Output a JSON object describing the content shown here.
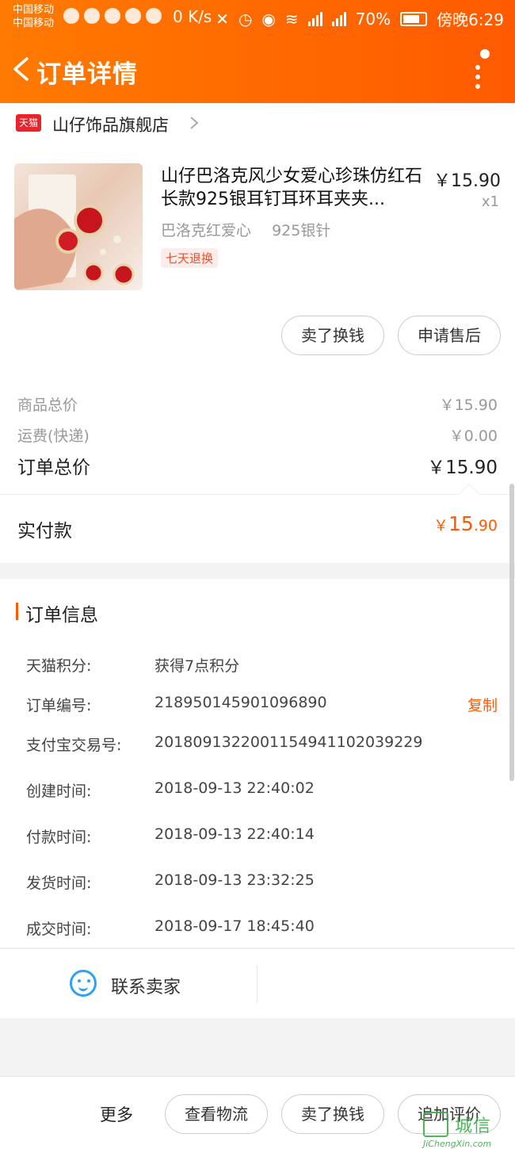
{
  "status_bar": {
    "carrier_1": "中国移动",
    "carrier_2": "中国移动",
    "speed": "0 K/s",
    "net1": "2G",
    "net2": "4G",
    "battery": "70%",
    "time": "傍晚6:29"
  },
  "nav": {
    "title": "订单详情"
  },
  "shop": {
    "platform_label": "天猫",
    "name": "山仔饰品旗舰店"
  },
  "product": {
    "title": "山仔巴洛克风少女爱心珍珠仿红石长款925银耳钉耳环耳夹夹...",
    "price": "￥15.90",
    "qty": "x1",
    "sku_1": "巴洛克红爱心",
    "sku_2": "925银针",
    "tag": "七天退换",
    "btn_resell": "卖了换钱",
    "btn_aftersale": "申请售后"
  },
  "summary": {
    "goods_total_label": "商品总价",
    "goods_total_value": "￥15.90",
    "shipping_label": "运费(快递)",
    "shipping_value": "￥0.00",
    "order_total_label": "订单总价",
    "order_total_value": "￥15.90",
    "paid_label": "实付款",
    "paid_currency": "￥",
    "paid_int": "15",
    "paid_dec": ".90"
  },
  "order_info": {
    "title": "订单信息",
    "rows": [
      {
        "label": "天猫积分:",
        "value": "获得7点积分"
      },
      {
        "label": "订单编号:",
        "value": "218950145901096890"
      },
      {
        "label": "支付宝交易号:",
        "value": "2018091322001154941102039229"
      },
      {
        "label": "创建时间:",
        "value": "2018-09-13 22:40:02"
      },
      {
        "label": "付款时间:",
        "value": "2018-09-13 22:40:14"
      },
      {
        "label": "发货时间:",
        "value": "2018-09-13 23:32:25"
      },
      {
        "label": "成交时间:",
        "value": "2018-09-17 18:45:40"
      }
    ],
    "copy_label": "复制"
  },
  "contact": {
    "label": "联系卖家"
  },
  "bottom": {
    "more": "更多",
    "btn_logistics": "查看物流",
    "btn_resell": "卖了换钱",
    "btn_review": "追加评价"
  },
  "watermark": {
    "text": "城信",
    "sub": "JiChengXin.com"
  }
}
